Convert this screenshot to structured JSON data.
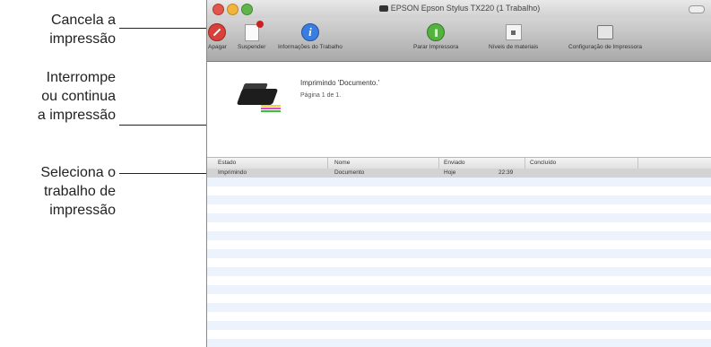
{
  "annotations": {
    "cancel": [
      "Cancela a",
      "impressão"
    ],
    "pause": [
      "Interrompe",
      "ou continua",
      "a impressão"
    ],
    "select": [
      "Seleciona o",
      "trabalho de",
      "impressão"
    ]
  },
  "window": {
    "title": "EPSON Epson Stylus TX220 (1 Trabalho)"
  },
  "toolbar": {
    "items": [
      {
        "label": "Apagar",
        "icon": "stop-icon"
      },
      {
        "label": "Suspender",
        "icon": "suspend-document-icon"
      },
      {
        "label": "Informações do Trabalho",
        "icon": "info-icon"
      },
      {
        "label": "Parar Impressora",
        "icon": "pause-printer-icon"
      },
      {
        "label": "Níveis de materiais",
        "icon": "supply-levels-icon"
      },
      {
        "label": "Configuração de Impressora",
        "icon": "printer-setup-icon"
      }
    ]
  },
  "status": {
    "title": "Imprimindo 'Documento.'",
    "page": "Página 1 de 1."
  },
  "table": {
    "headers": [
      "Estado",
      "Nome",
      "Enviado",
      "Concluído"
    ],
    "rows": [
      {
        "estado": "Imprimindo",
        "nome": "Documento",
        "enviado": "Hoje",
        "hora": "22:39",
        "concluido": ""
      }
    ]
  },
  "colors": {
    "stop": "#d8403a",
    "info": "#3a7de0",
    "pause": "#56b240",
    "row_stripe": "#edf3fd",
    "row_selected": "#d3d3d3"
  }
}
